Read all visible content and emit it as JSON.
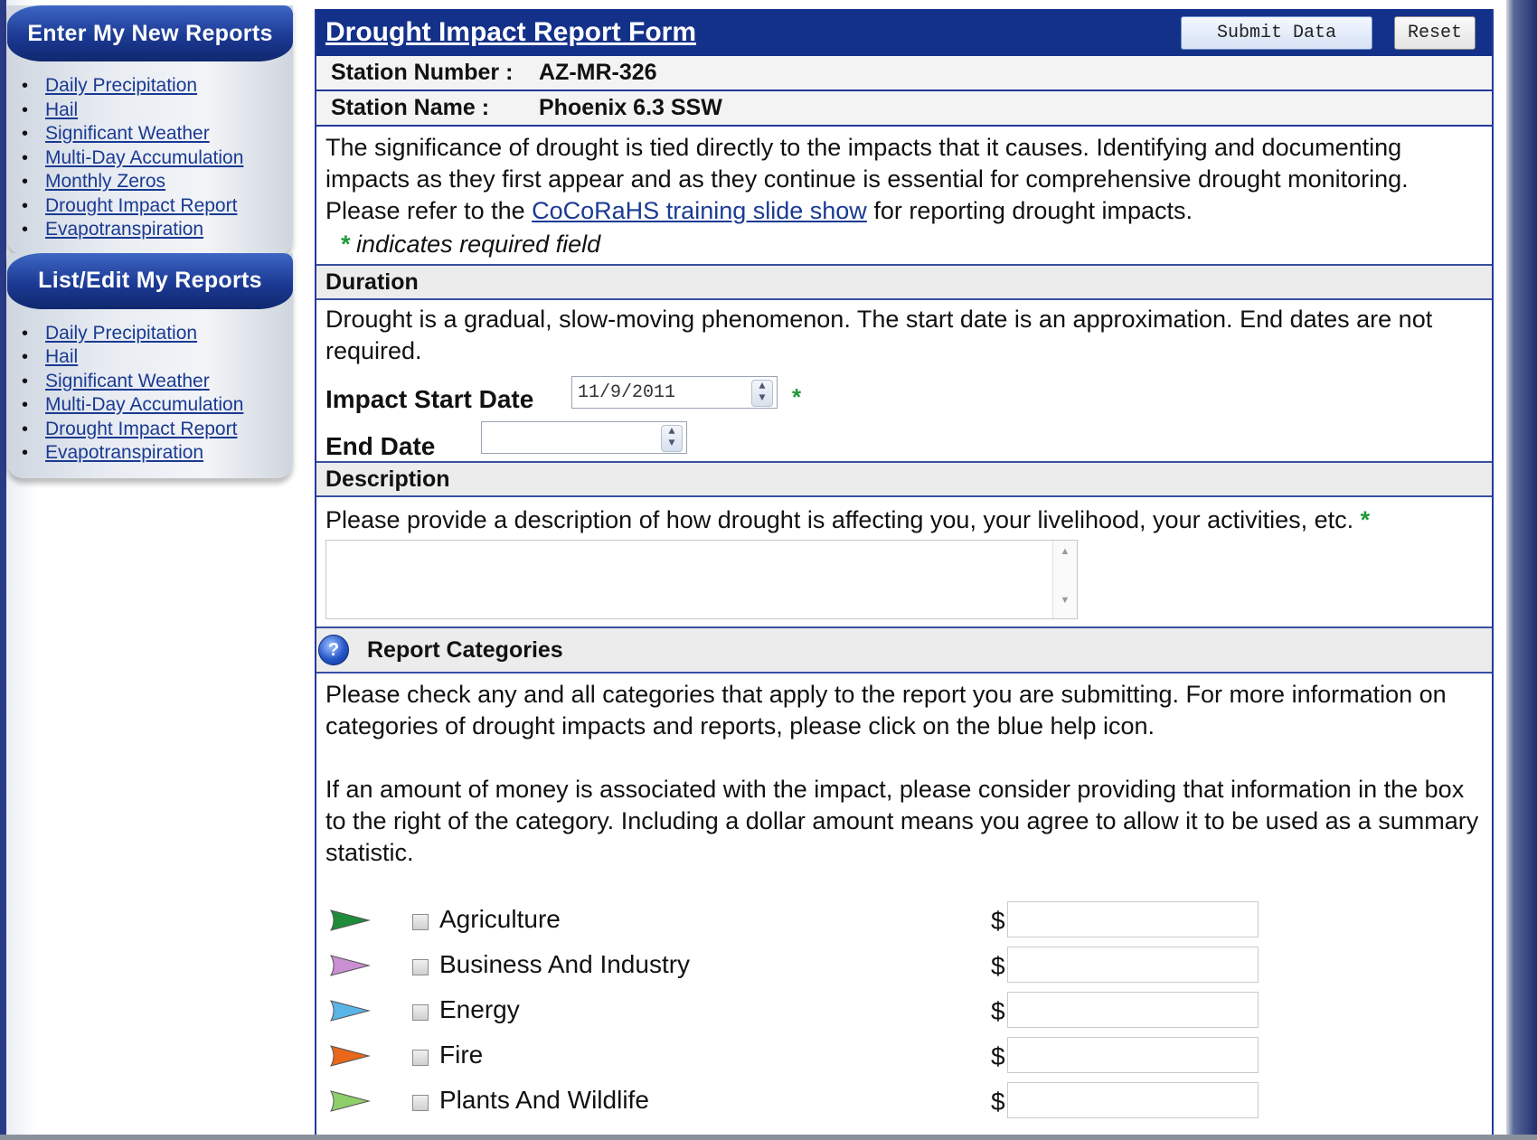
{
  "sidebar": {
    "new_reports": {
      "title": "Enter My New Reports",
      "items": [
        "Daily Precipitation",
        "Hail",
        "Significant Weather",
        "Multi-Day Accumulation",
        "Monthly Zeros",
        "Drought Impact Report",
        "Evapotranspiration"
      ]
    },
    "edit_reports": {
      "title": "List/Edit My Reports",
      "items": [
        "Daily Precipitation",
        "Hail",
        "Significant Weather",
        "Multi-Day Accumulation",
        "Drought Impact Report",
        "Evapotranspiration"
      ]
    }
  },
  "form": {
    "title": "Drought Impact Report Form",
    "submit_label": "Submit Data",
    "reset_label": "Reset",
    "station_number_label": "Station Number :",
    "station_number": "AZ-MR-326",
    "station_name_label": "Station Name :",
    "station_name": "Phoenix 6.3 SSW",
    "intro_before_link": "The significance of drought is tied directly to the impacts that it causes. Identifying and documenting impacts as they first appear and as they continue is essential for comprehensive drought monitoring. Please refer to the ",
    "intro_link": "CoCoRaHS training slide show",
    "intro_after_link": " for reporting drought impacts.",
    "required_star": "*",
    "required_note": " indicates required field",
    "duration": {
      "heading": "Duration",
      "text": "Drought is a gradual, slow-moving phenomenon. The start date is an approximation. End dates are not required.",
      "start_label": "Impact Start Date",
      "start_value": "11/9/2011",
      "end_label": "End Date",
      "end_value": ""
    },
    "description": {
      "heading": "Description",
      "prompt": "Please provide a description of how drought is affecting you, your livelihood, your activities, etc."
    },
    "categories": {
      "heading": "Report Categories",
      "help_icon": "?",
      "text1": "Please check any and all categories that apply to the report you are submitting. For more information on categories of drought impacts and reports, please click on the blue help icon.",
      "text2": "If an amount of money is associated with the impact, please consider providing that information in the box to the right of the category. Including a dollar amount means you agree to allow it to be used as a summary statistic.",
      "currency": "$",
      "items": [
        {
          "label": "Agriculture",
          "color": "#1e8c3a"
        },
        {
          "label": "Business And Industry",
          "color": "#c98fd0"
        },
        {
          "label": "Energy",
          "color": "#5ab4e6"
        },
        {
          "label": "Fire",
          "color": "#e8671b"
        },
        {
          "label": "Plants And Wildlife",
          "color": "#8fcf6a"
        }
      ]
    }
  }
}
